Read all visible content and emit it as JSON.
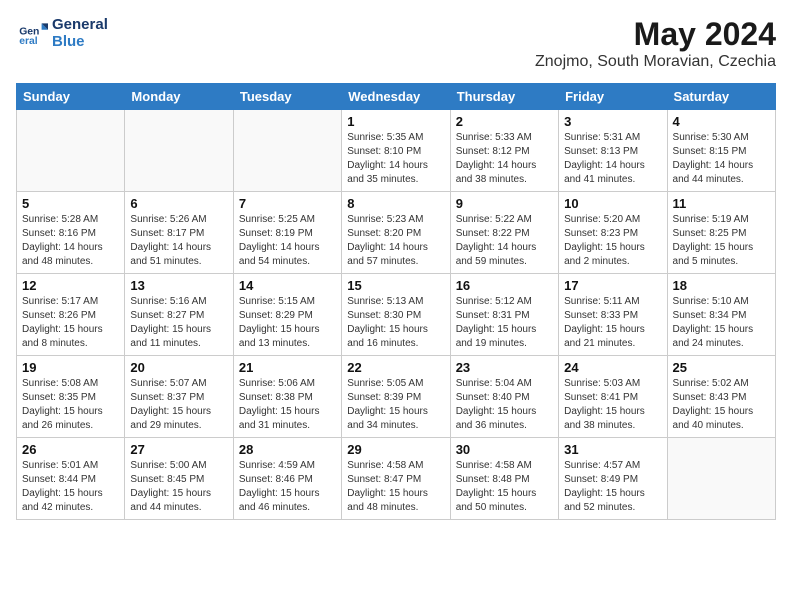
{
  "logo": {
    "line1": "General",
    "line2": "Blue"
  },
  "title": "May 2024",
  "subtitle": "Znojmo, South Moravian, Czechia",
  "days_of_week": [
    "Sunday",
    "Monday",
    "Tuesday",
    "Wednesday",
    "Thursday",
    "Friday",
    "Saturday"
  ],
  "weeks": [
    [
      {
        "day": "",
        "info": ""
      },
      {
        "day": "",
        "info": ""
      },
      {
        "day": "",
        "info": ""
      },
      {
        "day": "1",
        "info": "Sunrise: 5:35 AM\nSunset: 8:10 PM\nDaylight: 14 hours\nand 35 minutes."
      },
      {
        "day": "2",
        "info": "Sunrise: 5:33 AM\nSunset: 8:12 PM\nDaylight: 14 hours\nand 38 minutes."
      },
      {
        "day": "3",
        "info": "Sunrise: 5:31 AM\nSunset: 8:13 PM\nDaylight: 14 hours\nand 41 minutes."
      },
      {
        "day": "4",
        "info": "Sunrise: 5:30 AM\nSunset: 8:15 PM\nDaylight: 14 hours\nand 44 minutes."
      }
    ],
    [
      {
        "day": "5",
        "info": "Sunrise: 5:28 AM\nSunset: 8:16 PM\nDaylight: 14 hours\nand 48 minutes."
      },
      {
        "day": "6",
        "info": "Sunrise: 5:26 AM\nSunset: 8:17 PM\nDaylight: 14 hours\nand 51 minutes."
      },
      {
        "day": "7",
        "info": "Sunrise: 5:25 AM\nSunset: 8:19 PM\nDaylight: 14 hours\nand 54 minutes."
      },
      {
        "day": "8",
        "info": "Sunrise: 5:23 AM\nSunset: 8:20 PM\nDaylight: 14 hours\nand 57 minutes."
      },
      {
        "day": "9",
        "info": "Sunrise: 5:22 AM\nSunset: 8:22 PM\nDaylight: 14 hours\nand 59 minutes."
      },
      {
        "day": "10",
        "info": "Sunrise: 5:20 AM\nSunset: 8:23 PM\nDaylight: 15 hours\nand 2 minutes."
      },
      {
        "day": "11",
        "info": "Sunrise: 5:19 AM\nSunset: 8:25 PM\nDaylight: 15 hours\nand 5 minutes."
      }
    ],
    [
      {
        "day": "12",
        "info": "Sunrise: 5:17 AM\nSunset: 8:26 PM\nDaylight: 15 hours\nand 8 minutes."
      },
      {
        "day": "13",
        "info": "Sunrise: 5:16 AM\nSunset: 8:27 PM\nDaylight: 15 hours\nand 11 minutes."
      },
      {
        "day": "14",
        "info": "Sunrise: 5:15 AM\nSunset: 8:29 PM\nDaylight: 15 hours\nand 13 minutes."
      },
      {
        "day": "15",
        "info": "Sunrise: 5:13 AM\nSunset: 8:30 PM\nDaylight: 15 hours\nand 16 minutes."
      },
      {
        "day": "16",
        "info": "Sunrise: 5:12 AM\nSunset: 8:31 PM\nDaylight: 15 hours\nand 19 minutes."
      },
      {
        "day": "17",
        "info": "Sunrise: 5:11 AM\nSunset: 8:33 PM\nDaylight: 15 hours\nand 21 minutes."
      },
      {
        "day": "18",
        "info": "Sunrise: 5:10 AM\nSunset: 8:34 PM\nDaylight: 15 hours\nand 24 minutes."
      }
    ],
    [
      {
        "day": "19",
        "info": "Sunrise: 5:08 AM\nSunset: 8:35 PM\nDaylight: 15 hours\nand 26 minutes."
      },
      {
        "day": "20",
        "info": "Sunrise: 5:07 AM\nSunset: 8:37 PM\nDaylight: 15 hours\nand 29 minutes."
      },
      {
        "day": "21",
        "info": "Sunrise: 5:06 AM\nSunset: 8:38 PM\nDaylight: 15 hours\nand 31 minutes."
      },
      {
        "day": "22",
        "info": "Sunrise: 5:05 AM\nSunset: 8:39 PM\nDaylight: 15 hours\nand 34 minutes."
      },
      {
        "day": "23",
        "info": "Sunrise: 5:04 AM\nSunset: 8:40 PM\nDaylight: 15 hours\nand 36 minutes."
      },
      {
        "day": "24",
        "info": "Sunrise: 5:03 AM\nSunset: 8:41 PM\nDaylight: 15 hours\nand 38 minutes."
      },
      {
        "day": "25",
        "info": "Sunrise: 5:02 AM\nSunset: 8:43 PM\nDaylight: 15 hours\nand 40 minutes."
      }
    ],
    [
      {
        "day": "26",
        "info": "Sunrise: 5:01 AM\nSunset: 8:44 PM\nDaylight: 15 hours\nand 42 minutes."
      },
      {
        "day": "27",
        "info": "Sunrise: 5:00 AM\nSunset: 8:45 PM\nDaylight: 15 hours\nand 44 minutes."
      },
      {
        "day": "28",
        "info": "Sunrise: 4:59 AM\nSunset: 8:46 PM\nDaylight: 15 hours\nand 46 minutes."
      },
      {
        "day": "29",
        "info": "Sunrise: 4:58 AM\nSunset: 8:47 PM\nDaylight: 15 hours\nand 48 minutes."
      },
      {
        "day": "30",
        "info": "Sunrise: 4:58 AM\nSunset: 8:48 PM\nDaylight: 15 hours\nand 50 minutes."
      },
      {
        "day": "31",
        "info": "Sunrise: 4:57 AM\nSunset: 8:49 PM\nDaylight: 15 hours\nand 52 minutes."
      },
      {
        "day": "",
        "info": ""
      }
    ]
  ]
}
